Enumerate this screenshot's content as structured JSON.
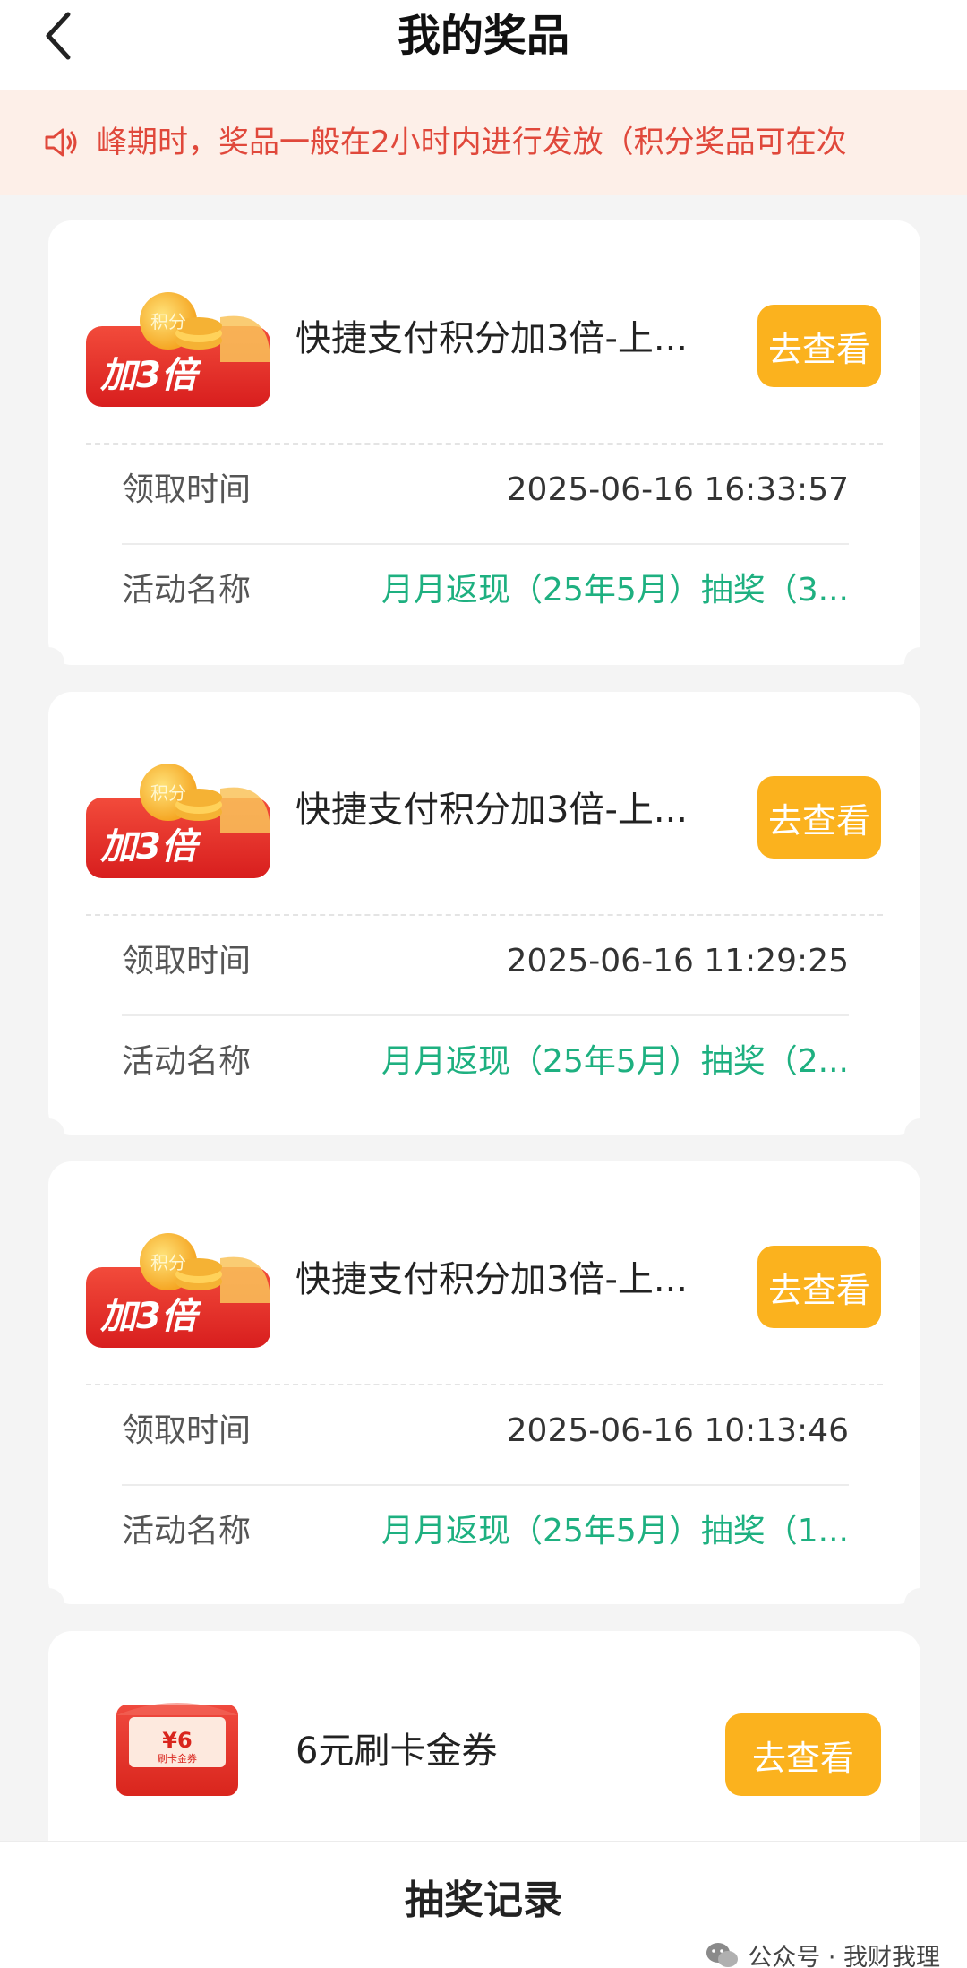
{
  "header": {
    "title": "我的奖品"
  },
  "notice": {
    "text": "峰期时，奖品一般在2小时内进行发放（积分奖品可在次"
  },
  "cards": [
    {
      "badge_label": "加3倍",
      "coin_label": "积分",
      "name": "快捷支付积分加3倍-上...",
      "button": "去查看",
      "time_label": "领取时间",
      "time_value": "2025-06-16 16:33:57",
      "activity_label": "活动名称",
      "activity_value": "月月返现（25年5月）抽奖（3..."
    },
    {
      "badge_label": "加3倍",
      "coin_label": "积分",
      "name": "快捷支付积分加3倍-上...",
      "button": "去查看",
      "time_label": "领取时间",
      "time_value": "2025-06-16 11:29:25",
      "activity_label": "活动名称",
      "activity_value": "月月返现（25年5月）抽奖（2..."
    },
    {
      "badge_label": "加3倍",
      "coin_label": "积分",
      "name": "快捷支付积分加3倍-上...",
      "button": "去查看",
      "time_label": "领取时间",
      "time_value": "2025-06-16 10:13:46",
      "activity_label": "活动名称",
      "activity_value": "月月返现（25年5月）抽奖（1..."
    },
    {
      "coupon_amount": "¥6",
      "coupon_caption": "刷卡金券",
      "name": "6元刷卡金券",
      "button": "去查看"
    }
  ],
  "bottom": {
    "record_label": "抽奖记录"
  },
  "watermark": {
    "text": "公众号 · 我财我理"
  },
  "colors": {
    "accent_button": "#fbb21e",
    "notice_text": "#e0483b",
    "activity_text": "#1eb080"
  }
}
